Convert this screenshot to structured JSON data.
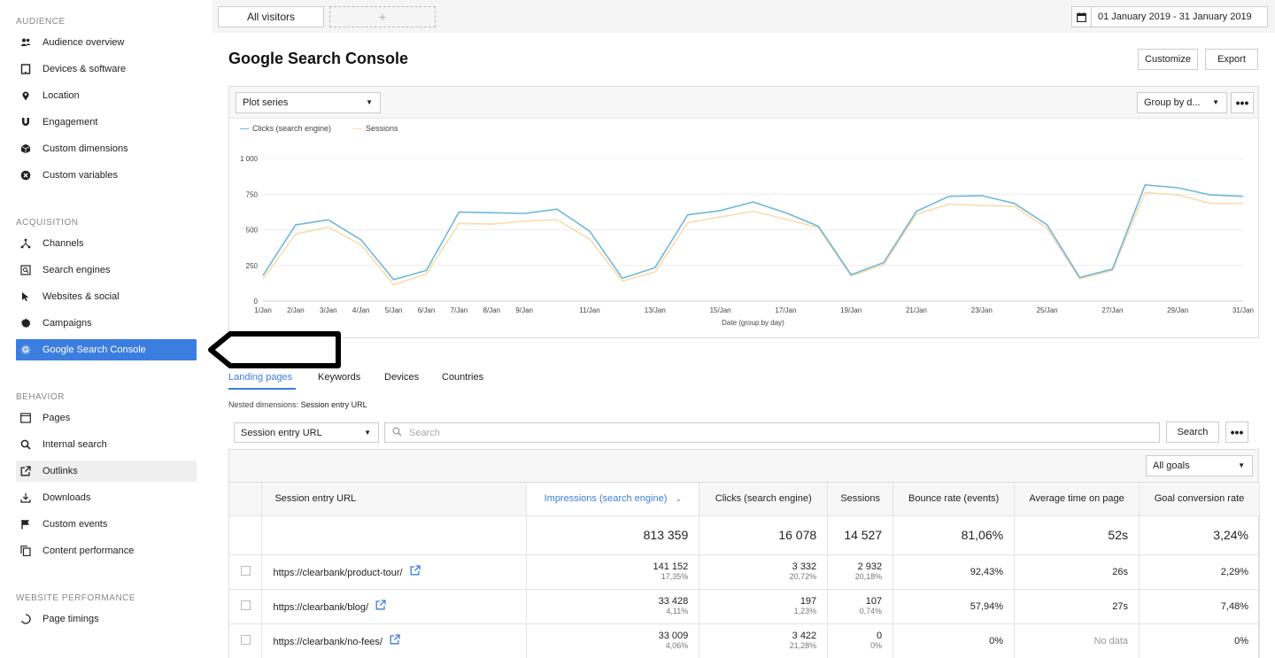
{
  "sidebar": {
    "sections": [
      {
        "title": "AUDIENCE",
        "items": [
          {
            "label": "Audience overview",
            "icon": "users-icon"
          },
          {
            "label": "Devices & software",
            "icon": "tablet-icon"
          },
          {
            "label": "Location",
            "icon": "map-pin-icon"
          },
          {
            "label": "Engagement",
            "icon": "magnet-icon"
          },
          {
            "label": "Custom dimensions",
            "icon": "cube-icon"
          },
          {
            "label": "Custom variables",
            "icon": "x-circle-icon"
          }
        ]
      },
      {
        "title": "ACQUISITION",
        "items": [
          {
            "label": "Channels",
            "icon": "share-icon"
          },
          {
            "label": "Search engines",
            "icon": "search-engine-icon"
          },
          {
            "label": "Websites & social",
            "icon": "cursor-icon"
          },
          {
            "label": "Campaigns",
            "icon": "badge-icon"
          },
          {
            "label": "Google Search Console",
            "icon": "google-icon"
          }
        ]
      },
      {
        "title": "BEHAVIOR",
        "items": [
          {
            "label": "Pages",
            "icon": "browser-icon"
          },
          {
            "label": "Internal search",
            "icon": "search-icon"
          },
          {
            "label": "Outlinks",
            "icon": "external-link-icon"
          },
          {
            "label": "Downloads",
            "icon": "download-icon"
          },
          {
            "label": "Custom events",
            "icon": "flag-icon"
          },
          {
            "label": "Content performance",
            "icon": "copy-icon"
          }
        ]
      },
      {
        "title": "WEBSITE PERFORMANCE",
        "items": [
          {
            "label": "Page timings",
            "icon": "spinner-icon"
          }
        ]
      }
    ],
    "active_item": "Google Search Console",
    "hover_item": "Outlinks"
  },
  "topbar": {
    "segment": "All visitors",
    "add_segment": "+",
    "date_range": "01 January 2019 - 31 January 2019"
  },
  "page": {
    "title": "Google Search Console",
    "customize": "Customize",
    "export": "Export"
  },
  "chart_panel": {
    "plot_series": "Plot series",
    "group_by": "Group by d...",
    "more": "•••"
  },
  "chart_data": {
    "type": "line",
    "xlabel": "Date (group by day)",
    "ylabel": "",
    "ylim": [
      0,
      1000
    ],
    "yticks": [
      "0",
      "250",
      "500",
      "750",
      "1 000"
    ],
    "x": [
      "1/Jan",
      "2/Jan",
      "3/Jan",
      "4/Jan",
      "5/Jan",
      "6/Jan",
      "7/Jan",
      "8/Jan",
      "9/Jan",
      "10/Jan",
      "11/Jan",
      "12/Jan",
      "13/Jan",
      "14/Jan",
      "15/Jan",
      "16/Jan",
      "17/Jan",
      "18/Jan",
      "19/Jan",
      "20/Jan",
      "21/Jan",
      "22/Jan",
      "23/Jan",
      "24/Jan",
      "25/Jan",
      "26/Jan",
      "27/Jan",
      "28/Jan",
      "29/Jan",
      "30/Jan",
      "31/Jan"
    ],
    "xtick_labels": [
      "1/Jan",
      "2/Jan",
      "3/Jan",
      "4/Jan",
      "5/Jan",
      "6/Jan",
      "7/Jan",
      "8/Jan",
      "9/Jan",
      "",
      "11/Jan",
      "",
      "13/Jan",
      "",
      "15/Jan",
      "",
      "17/Jan",
      "",
      "19/Jan",
      "",
      "21/Jan",
      "",
      "23/Jan",
      "",
      "25/Jan",
      "",
      "27/Jan",
      "",
      "29/Jan",
      "",
      "31/Jan"
    ],
    "series": [
      {
        "name": "Clicks (search engine)",
        "color": "#6fb9d6",
        "values": [
          180,
          535,
          570,
          430,
          150,
          215,
          625,
          620,
          615,
          645,
          490,
          160,
          235,
          605,
          635,
          695,
          620,
          525,
          185,
          270,
          630,
          735,
          740,
          685,
          535,
          165,
          225,
          815,
          795,
          745,
          735
        ]
      },
      {
        "name": "Sessions",
        "color": "#f7ddb0",
        "values": [
          155,
          470,
          520,
          395,
          115,
          190,
          545,
          540,
          560,
          570,
          435,
          140,
          205,
          550,
          590,
          630,
          575,
          515,
          175,
          255,
          610,
          680,
          670,
          665,
          510,
          155,
          215,
          760,
          745,
          685,
          685
        ]
      }
    ],
    "grid": true,
    "legend_position": "top-left"
  },
  "tabs": [
    "Landing pages",
    "Keywords",
    "Devices",
    "Countries"
  ],
  "nested": {
    "prefix": "Nested dimensions:",
    "value": "Session entry URL"
  },
  "filter": {
    "dimension": "Session entry URL",
    "search_placeholder": "Search",
    "search_button": "Search",
    "more": "•••",
    "goals": "All goals"
  },
  "table": {
    "headers": [
      "Session entry URL",
      "Impressions (search engine)",
      "Clicks (search engine)",
      "Sessions",
      "Bounce rate (events)",
      "Average time on page",
      "Goal conversion rate"
    ],
    "sort_indicator": "⌄",
    "totals": [
      "813 359",
      "16 078",
      "14 527",
      "81,06%",
      "52s",
      "3,24%"
    ],
    "rows": [
      {
        "url": "https://clearbank/product-tour/",
        "impressions": "141 152",
        "impressions_pct": "17,35%",
        "clicks": "3 332",
        "clicks_pct": "20,72%",
        "sessions": "2 932",
        "sessions_pct": "20,18%",
        "bounce": "92,43%",
        "avg_time": "26s",
        "goal": "2,29%"
      },
      {
        "url": "https://clearbank/blog/",
        "impressions": "33 428",
        "impressions_pct": "4,11%",
        "clicks": "197",
        "clicks_pct": "1,23%",
        "sessions": "107",
        "sessions_pct": "0,74%",
        "bounce": "57,94%",
        "avg_time": "27s",
        "goal": "7,48%"
      },
      {
        "url": "https://clearbank/no-fees/",
        "impressions": "33 009",
        "impressions_pct": "4,06%",
        "clicks": "3 422",
        "clicks_pct": "21,28%",
        "sessions": "0",
        "sessions_pct": "0%",
        "bounce": "0%",
        "avg_time": "No data",
        "goal": "0%"
      }
    ]
  }
}
